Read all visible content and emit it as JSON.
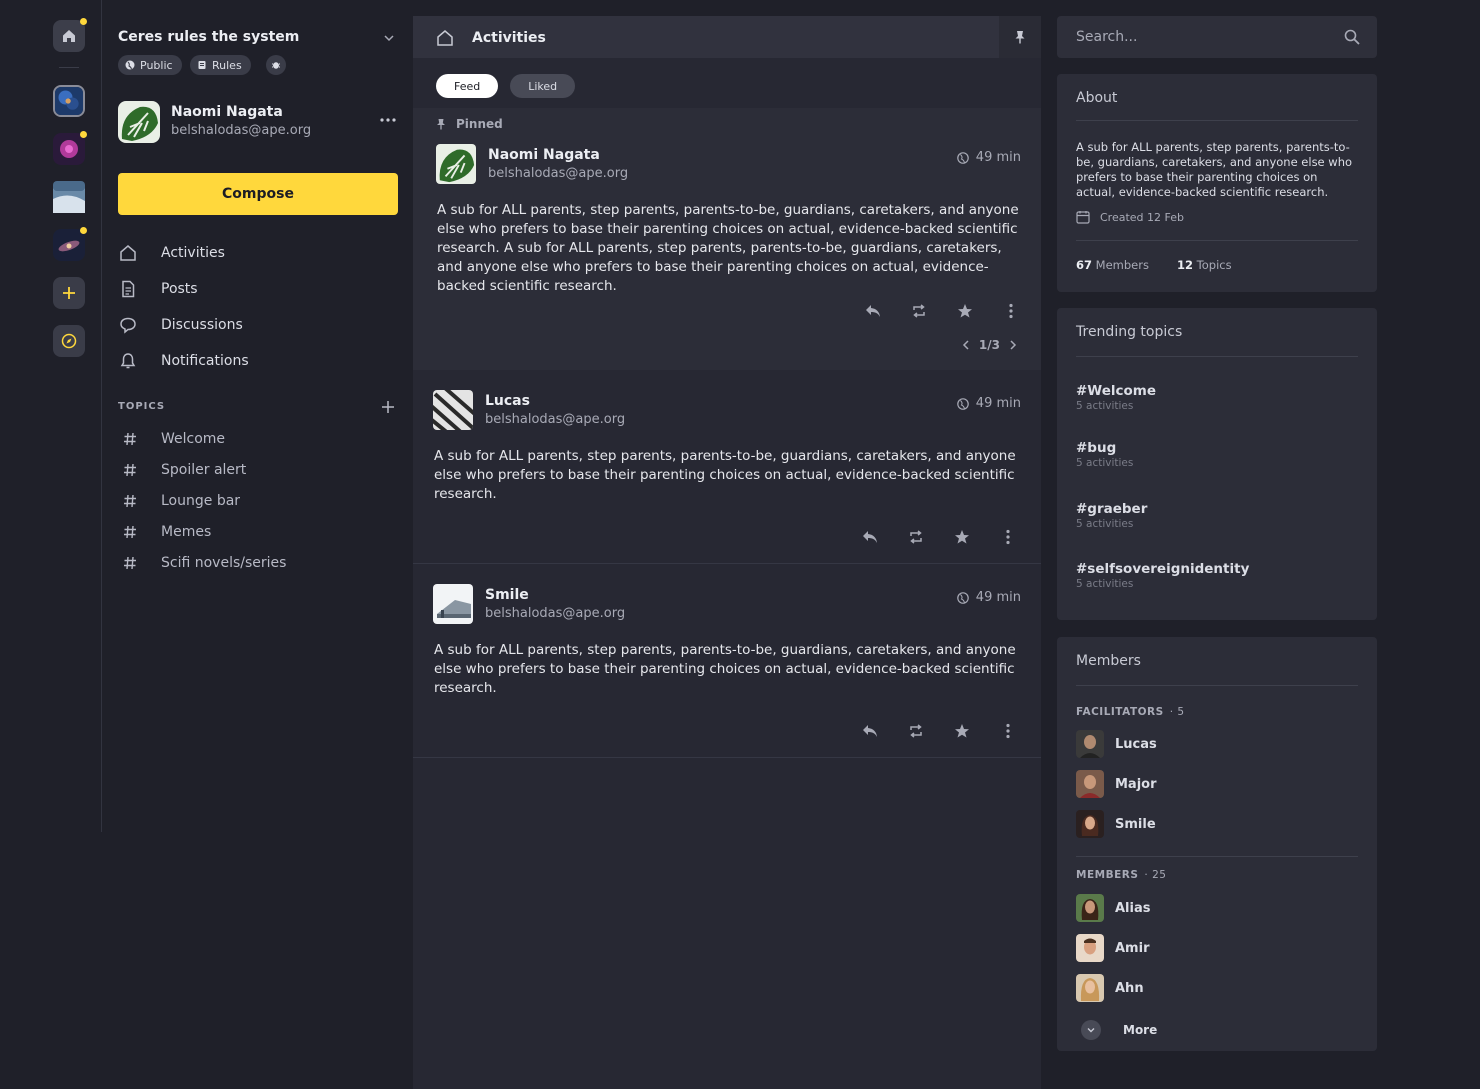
{
  "community": {
    "title": "Ceres rules the system",
    "badges": {
      "public": "Public",
      "rules": "Rules"
    }
  },
  "profile": {
    "name": "Naomi Nagata",
    "email": "belshalodas@ape.org"
  },
  "compose_label": "Compose",
  "nav": [
    {
      "label": "Activities",
      "icon": "home-icon"
    },
    {
      "label": "Posts",
      "icon": "document-icon"
    },
    {
      "label": "Discussions",
      "icon": "chat-bubble-icon"
    },
    {
      "label": "Notifications",
      "icon": "bell-icon"
    }
  ],
  "topics": {
    "header": "TOPICS",
    "items": [
      "Welcome",
      "Spoiler alert",
      "Lounge bar",
      "Memes",
      "Scifi novels/series"
    ]
  },
  "feed": {
    "title": "Activities",
    "tabs": [
      "Feed",
      "Liked"
    ],
    "pinned_label": "Pinned",
    "pager": "1/3",
    "posts": [
      {
        "name": "Naomi Nagata",
        "email": "belshalodas@ape.org",
        "time": "49 min",
        "body": "A sub for ALL parents, step parents, parents-to-be, guardians, caretakers, and anyone else who prefers to base their parenting choices on actual, evidence-backed scientific research. A sub for ALL parents, step parents, parents-to-be, guardians, caretakers, and anyone else who prefers to base their parenting choices on actual, evidence-backed scientific research."
      },
      {
        "name": "Lucas",
        "email": "belshalodas@ape.org",
        "time": "49 min",
        "body": "A sub for ALL parents, step parents, parents-to-be, guardians, caretakers, and anyone else who prefers to base their parenting choices on actual, evidence-backed scientific research."
      },
      {
        "name": "Smile",
        "email": "belshalodas@ape.org",
        "time": "49 min",
        "body": "A sub for ALL parents, step parents, parents-to-be, guardians, caretakers, and anyone else who prefers to base their parenting choices on actual, evidence-backed scientific research."
      }
    ]
  },
  "search": {
    "placeholder": "Search..."
  },
  "about": {
    "title": "About",
    "text": "A sub for ALL parents, step parents, parents-to-be, guardians, caretakers, and anyone else who prefers to base their parenting choices on actual, evidence-backed scientific research.",
    "created": "Created 12 Feb",
    "members_count": "67",
    "members_label": "Members",
    "topics_count": "12",
    "topics_label": "Topics"
  },
  "trending": {
    "title": "Trending topics",
    "items": [
      {
        "tag": "#Welcome",
        "count": "5 activities"
      },
      {
        "tag": "#bug",
        "count": "5 activities"
      },
      {
        "tag": "#graeber",
        "count": "5 activities"
      },
      {
        "tag": "#selfsovereignidentity",
        "count": "5 activities"
      }
    ]
  },
  "members": {
    "title": "Members",
    "facilitators_label": "FACILITATORS",
    "facilitators_count": "· 5",
    "facilitators": [
      "Lucas",
      "Major",
      "Smile"
    ],
    "members_label": "MEMBERS",
    "members_count": "· 25",
    "members": [
      "Alias",
      "Amir",
      "Ahn"
    ],
    "more_label": "More"
  },
  "colors": {
    "accent": "#ffd83c",
    "background": "#1f2029",
    "panel": "#2c2d38"
  }
}
